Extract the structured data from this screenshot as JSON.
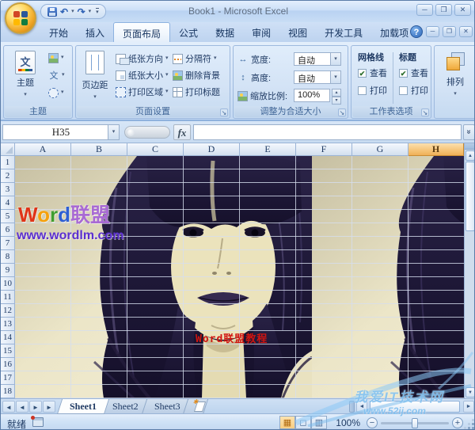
{
  "window": {
    "title": "Book1 - Microsoft Excel"
  },
  "icons": {
    "dropdown": "▾",
    "name_box_dropdown": "▼",
    "undo": "↶",
    "redo": "↷",
    "help": "?",
    "minimize": "─",
    "restore": "❐",
    "close": "✕",
    "fx": "fx",
    "formula_expand": "»",
    "scroll_up": "▲",
    "scroll_down": "▼",
    "scroll_left": "◄",
    "scroll_right": "►",
    "nav_first": "◄",
    "nav_last": "►",
    "zoom_out": "−",
    "zoom_in": "+",
    "spinner_up": "▴",
    "spinner_down": "▾",
    "launcher": "↘",
    "check": "✔",
    "view_normal": "▦",
    "view_layout": "◻",
    "view_break": "▥",
    "theme_glyph": "文"
  },
  "ribbon": {
    "tabs": [
      "开始",
      "插入",
      "页面布局",
      "公式",
      "数据",
      "审阅",
      "视图",
      "开发工具",
      "加载项"
    ],
    "active_tab": "页面布局",
    "themes": {
      "label": "主题",
      "big": "主题"
    },
    "page_setup": {
      "label": "页面设置",
      "margins": "页边距",
      "orientation": "纸张方向",
      "paper_size": "纸张大小",
      "print_area": "打印区域",
      "breaks": "分隔符",
      "delete_background": "删除背景",
      "print_titles": "打印标题"
    },
    "scale_to_fit": {
      "label": "调整为合适大小",
      "width": "宽度:",
      "width_value": "自动",
      "height": "高度:",
      "height_value": "自动",
      "scale": "缩放比例:",
      "scale_value": "100%"
    },
    "sheet_options": {
      "label": "工作表选项",
      "gridlines": "网格线",
      "headings": "标题",
      "view": "查看",
      "print": "打印",
      "gridlines_view_checked": true,
      "gridlines_print_checked": false,
      "headings_view_checked": true,
      "headings_print_checked": false
    },
    "arrange": {
      "label": "排列"
    }
  },
  "formula_bar": {
    "name_box": "H35",
    "value": ""
  },
  "grid": {
    "columns": [
      "A",
      "B",
      "C",
      "D",
      "E",
      "F",
      "G",
      "H"
    ],
    "selected_column": "H",
    "rows": [
      "1",
      "2",
      "3",
      "4",
      "5",
      "6",
      "7",
      "8",
      "9",
      "10",
      "11",
      "12",
      "13",
      "14",
      "15",
      "16",
      "17",
      "18"
    ],
    "cell_note": {
      "text": "Word联盟教程",
      "color": "#d01510"
    }
  },
  "watermarks": {
    "wordlm": {
      "l0": "W",
      "l1": "o",
      "l2": "r",
      "l3": "d",
      "suffix": "联盟",
      "colors": {
        "w": "#e03418",
        "o": "#f5a10c",
        "r": "#3f9e2f",
        "d": "#2e5fd4",
        "suffix": "#a86ad4",
        "url": "#5b2fd0"
      },
      "url": "www.wordlm.com"
    },
    "site": {
      "name": "我爱IT技术网",
      "url": "www.52ij.com",
      "color": "#7db9e8"
    }
  },
  "sheet_bar": {
    "tabs": [
      "Sheet1",
      "Sheet2",
      "Sheet3"
    ],
    "active_tab": "Sheet1"
  },
  "status_bar": {
    "ready": "就绪",
    "zoom": "100%"
  }
}
